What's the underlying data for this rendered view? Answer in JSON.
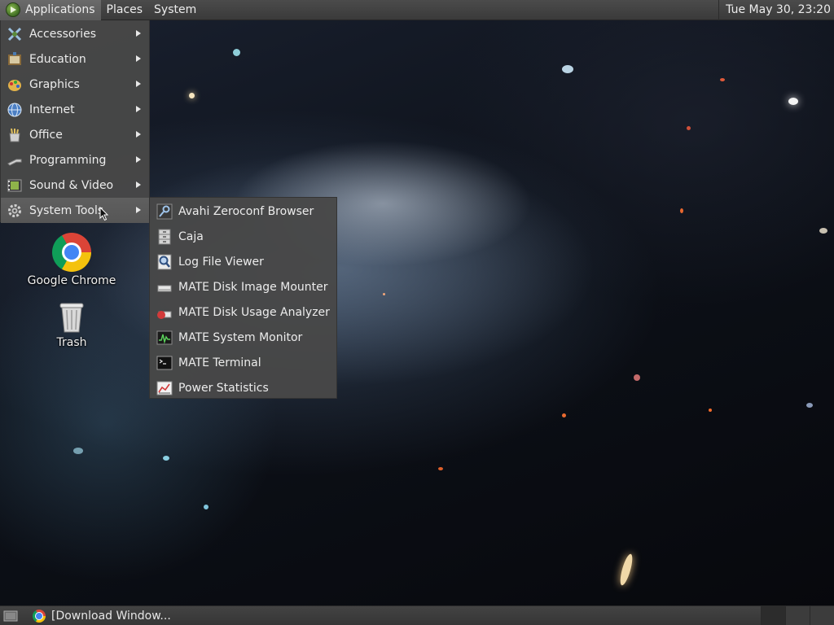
{
  "top_panel": {
    "applications_label": "Applications",
    "places_label": "Places",
    "system_label": "System",
    "clock": "Tue May 30, 23:20"
  },
  "main_menu": {
    "items": [
      {
        "label": "Accessories",
        "icon": "accessories-icon"
      },
      {
        "label": "Education",
        "icon": "education-icon"
      },
      {
        "label": "Graphics",
        "icon": "graphics-icon"
      },
      {
        "label": "Internet",
        "icon": "internet-icon"
      },
      {
        "label": "Office",
        "icon": "office-icon"
      },
      {
        "label": "Programming",
        "icon": "programming-icon"
      },
      {
        "label": "Sound & Video",
        "icon": "sound-video-icon"
      },
      {
        "label": "System Tools",
        "icon": "system-tools-icon"
      }
    ],
    "highlighted": "System Tools"
  },
  "system_tools_menu": {
    "items": [
      {
        "label": "Avahi Zeroconf Browser",
        "icon": "avahi-icon"
      },
      {
        "label": "Caja",
        "icon": "file-cabinet-icon"
      },
      {
        "label": "Log File Viewer",
        "icon": "log-viewer-icon"
      },
      {
        "label": "MATE Disk Image Mounter",
        "icon": "disk-image-icon"
      },
      {
        "label": "MATE Disk Usage Analyzer",
        "icon": "disk-usage-icon"
      },
      {
        "label": "MATE System Monitor",
        "icon": "system-monitor-icon"
      },
      {
        "label": "MATE Terminal",
        "icon": "terminal-icon"
      },
      {
        "label": "Power Statistics",
        "icon": "power-statistics-icon"
      }
    ]
  },
  "desktop": {
    "icons": [
      {
        "label": "Google Chrome",
        "icon": "chrome-icon"
      },
      {
        "label": "Trash",
        "icon": "trash-icon"
      }
    ]
  },
  "bottom_panel": {
    "task_label": "[Download Window...",
    "task_icon": "chrome-icon",
    "workspace_count": 3
  },
  "colors": {
    "panel": "#3f3f3f",
    "menu_bg": "#484848",
    "menu_highlight": "#5c5c5c",
    "text": "#ececec"
  }
}
